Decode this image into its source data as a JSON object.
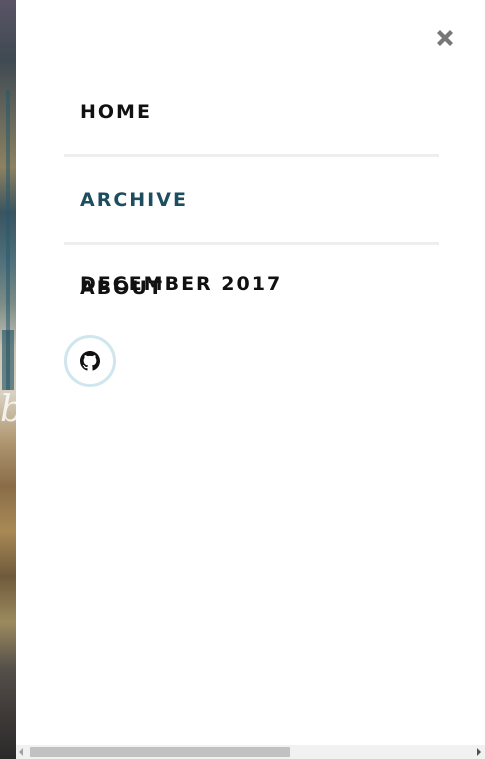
{
  "background": {
    "glyph": "b"
  },
  "drawer": {
    "close_icon": "close-icon",
    "nav": [
      {
        "label": "HOME"
      },
      {
        "label": "ARCHIVE",
        "active": true,
        "color": "#1d4e60"
      },
      {
        "label": "ABOUT"
      }
    ],
    "overlay_text": "DECEMBER 2017",
    "social": [
      {
        "icon": "github-icon"
      }
    ]
  },
  "colors": {
    "accent": "#1d4e60",
    "divider": "#eeeeee",
    "github_ring": "#cfe6ef",
    "close_icon": "#777777"
  }
}
